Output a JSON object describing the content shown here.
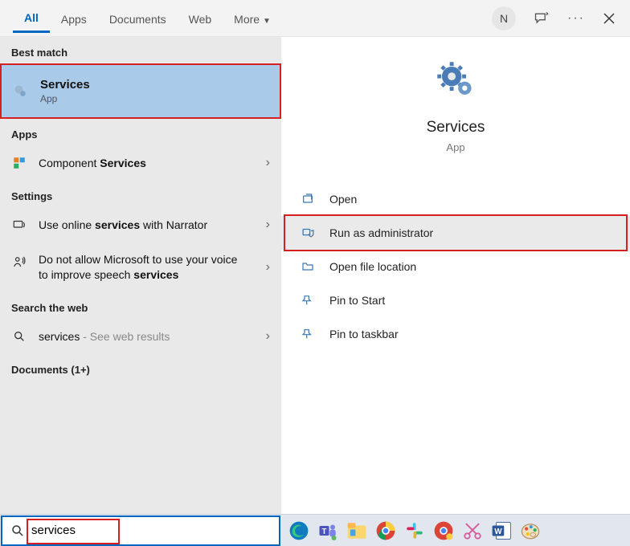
{
  "tabs": {
    "all": "All",
    "apps": "Apps",
    "documents": "Documents",
    "web": "Web",
    "more": "More"
  },
  "header": {
    "avatar_initial": "N"
  },
  "sections": {
    "best_match": "Best match",
    "apps": "Apps",
    "settings": "Settings",
    "web": "Search the web",
    "documents": "Documents (1+)"
  },
  "best": {
    "title": "Services",
    "sub": "App"
  },
  "apps_list": {
    "component_pre": "Component ",
    "component_bold": "Services"
  },
  "settings_list": {
    "s1_pre": "Use online ",
    "s1_bold": "services",
    "s1_post": " with Narrator",
    "s2_pre": "Do not allow Microsoft to use your voice to improve speech ",
    "s2_bold": "services"
  },
  "web_list": {
    "query": "services",
    "hint": " - See web results"
  },
  "preview": {
    "title": "Services",
    "sub": "App"
  },
  "actions": {
    "open": "Open",
    "run_admin": "Run as administrator",
    "open_loc": "Open file location",
    "pin_start": "Pin to Start",
    "pin_taskbar": "Pin to taskbar"
  },
  "search": {
    "value": "services"
  }
}
